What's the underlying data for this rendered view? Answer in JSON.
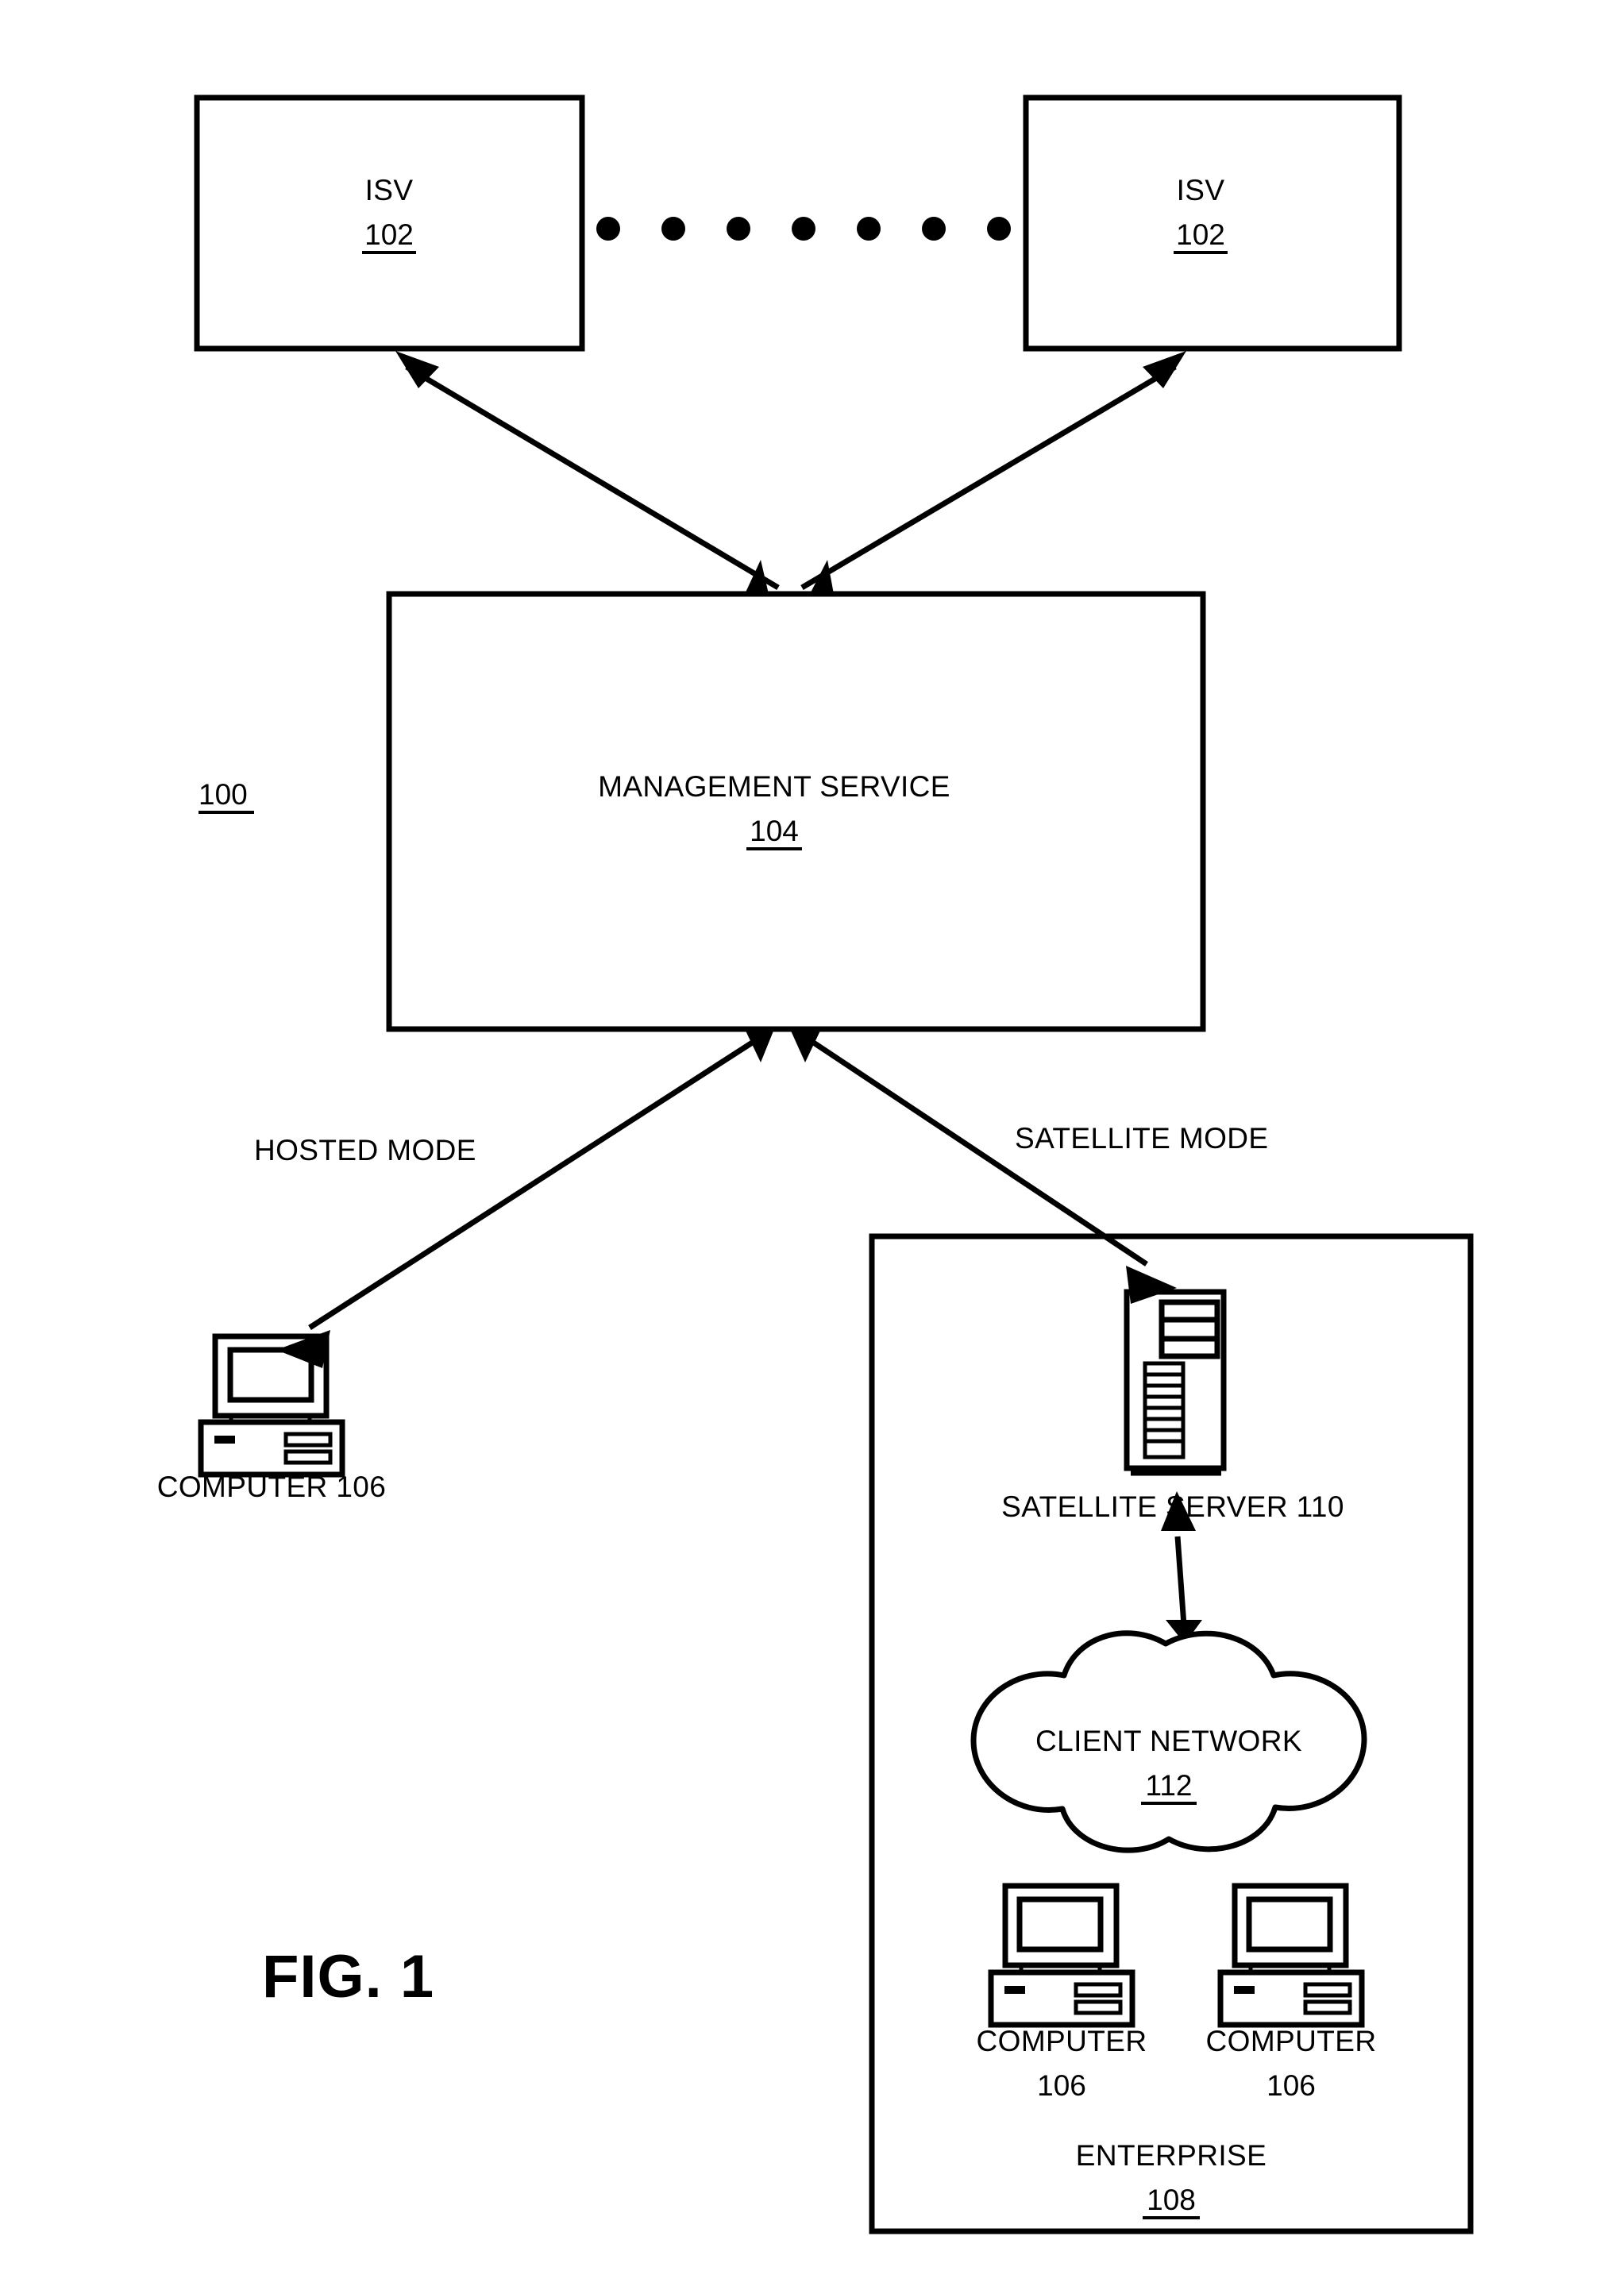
{
  "figure": {
    "label": "FIG. 1",
    "system_ref": "100"
  },
  "nodes": {
    "isv_left": {
      "title": "ISV",
      "ref": "102"
    },
    "isv_right": {
      "title": "ISV",
      "ref": "102"
    },
    "management_service": {
      "title": "MANAGEMENT SERVICE",
      "ref": "104"
    },
    "hosted_computer": {
      "label": "COMPUTER 106",
      "icon": "desktop-computer-icon"
    },
    "satellite_server": {
      "label": "SATELLITE SERVER 110",
      "icon": "server-tower-icon"
    },
    "client_network": {
      "title": "CLIENT NETWORK",
      "ref": "112",
      "icon": "cloud-icon"
    },
    "enterprise_computer_1": {
      "label_line1": "COMPUTER",
      "label_line2": "106",
      "icon": "desktop-computer-icon"
    },
    "enterprise_computer_2": {
      "label_line1": "COMPUTER",
      "label_line2": "106",
      "icon": "desktop-computer-icon"
    },
    "enterprise": {
      "title": "ENTERPRISE",
      "ref": "108"
    }
  },
  "connectors": {
    "hosted_mode": "HOSTED MODE",
    "satellite_mode": "SATELLITE MODE",
    "ellipsis_dot_count": 7
  },
  "colors": {
    "stroke": "#000000",
    "background": "#ffffff"
  }
}
